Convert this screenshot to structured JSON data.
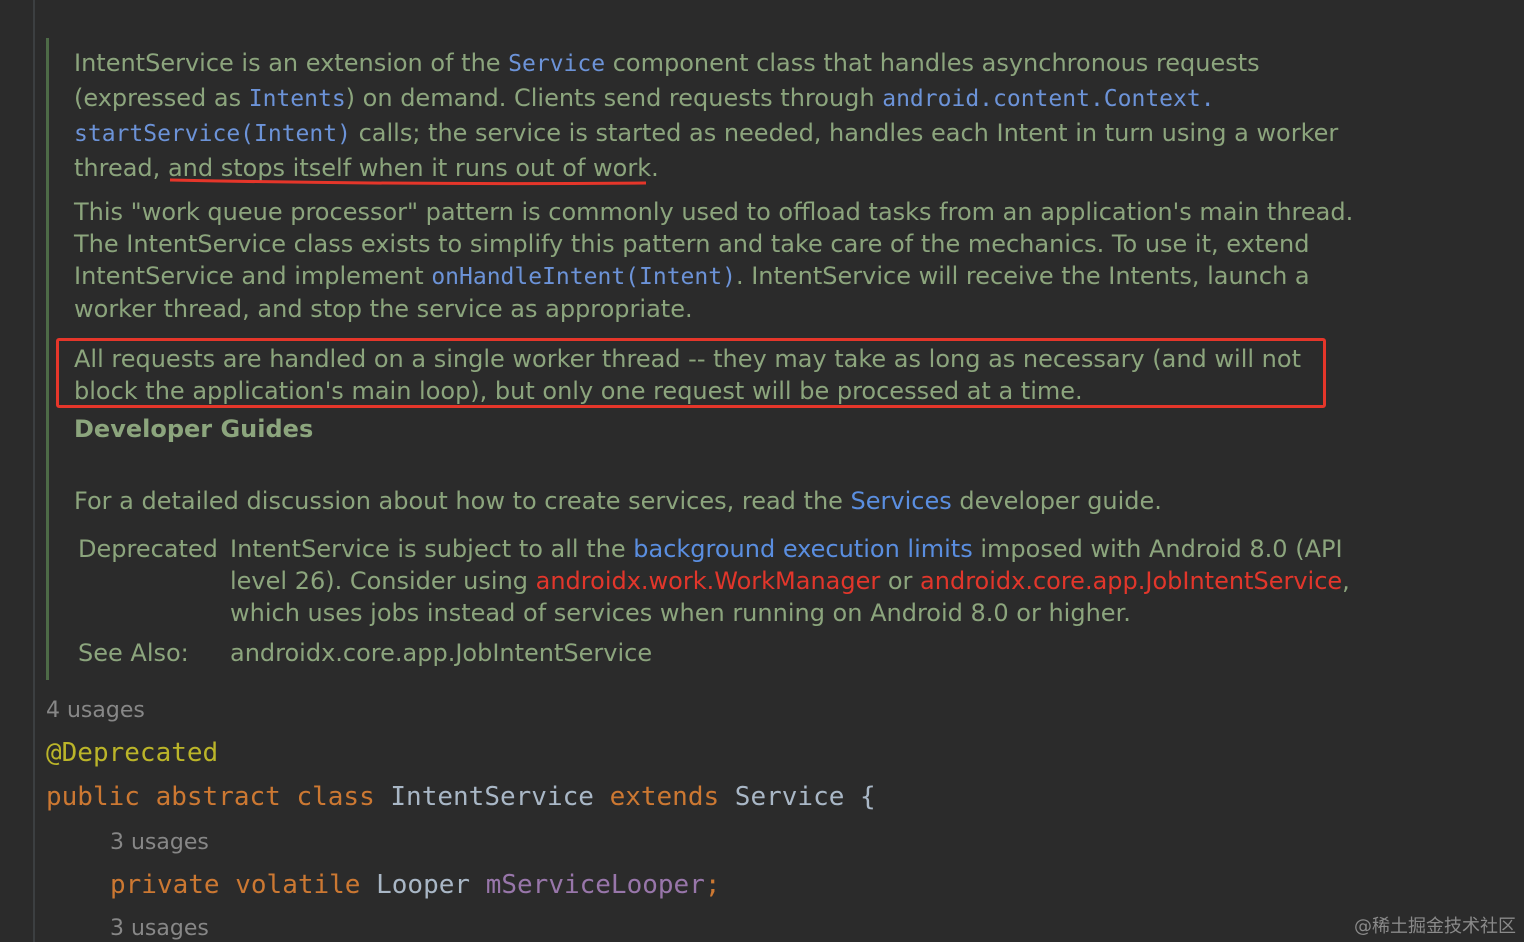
{
  "doc": {
    "p1": {
      "t1": "IntentService is an extension of the ",
      "service_link": "Service",
      "t2": " component class that handles asynchronous requests",
      "t3": "(expressed as ",
      "intents_link": "Intents",
      "t4": ") on demand. Clients send requests through ",
      "context_link": "android.content.Context.",
      "start_service_link": "startService(Intent)",
      "t5": " calls; the service is started as needed, handles each Intent in turn using a worker",
      "t6": "thread, ",
      "t7": "and stops itself when it runs out of work."
    },
    "p2": {
      "l1": "This \"work queue processor\" pattern is commonly used to offload tasks from an application's main thread.",
      "l2": "The IntentService class exists to simplify this pattern and take care of the mechanics. To use it, extend",
      "l3a": "IntentService and implement ",
      "on_handle_link": "onHandleIntent(Intent)",
      "l3b": ". IntentService will receive the Intents, launch a",
      "l4": "worker thread, and stop the service as appropriate."
    },
    "p3": {
      "l1": "All requests are handled on a single worker thread -- they may take as long as necessary (and will not",
      "l2": "block the application's main loop), but only one request will be processed at a time."
    },
    "dev_guides_heading": "Developer Guides",
    "p4": {
      "t1": "For a detailed discussion about how to create services, read the ",
      "services_link": "Services",
      "t2": " developer guide."
    },
    "deprecated": {
      "label": "Deprecated",
      "l1a": "IntentService is subject to all the ",
      "bg_limits_link": "background execution limits",
      "l1b": " imposed with Android 8.0 (API",
      "l2a": "level 26). Consider using ",
      "workmanager_link": "androidx.work.WorkManager",
      "l2b": " or ",
      "jobintent_link": "androidx.core.app.JobIntentService",
      "l2c": ",",
      "l3": "which uses jobs instead of services when running on Android 8.0 or higher."
    },
    "see_also": {
      "label": "See Also:",
      "link": "androidx.core.app.JobIntentService"
    }
  },
  "code": {
    "usages_class": "4 usages",
    "annotation": "@Deprecated",
    "kw_public": "public",
    "kw_abstract": "abstract",
    "kw_class": "class",
    "class_name": "IntentService",
    "kw_extends": "extends",
    "super_name": "Service",
    "brace": "{",
    "usages_field1": "3 usages",
    "kw_private": "private",
    "kw_volatile": "volatile",
    "field_type": "Looper",
    "field_name": "mServiceLooper",
    "semicolon": ";",
    "usages_field2": "3 usages"
  },
  "watermark": "@稀土掘金技术社区",
  "colors": {
    "background": "#2b2b2b",
    "doc_text": "#8ca57d",
    "link": "#5a8ee0",
    "deprecated_link": "#e2362b",
    "highlight_box": "#e5362a",
    "keyword": "#cc7832",
    "annotation": "#bbb529"
  }
}
